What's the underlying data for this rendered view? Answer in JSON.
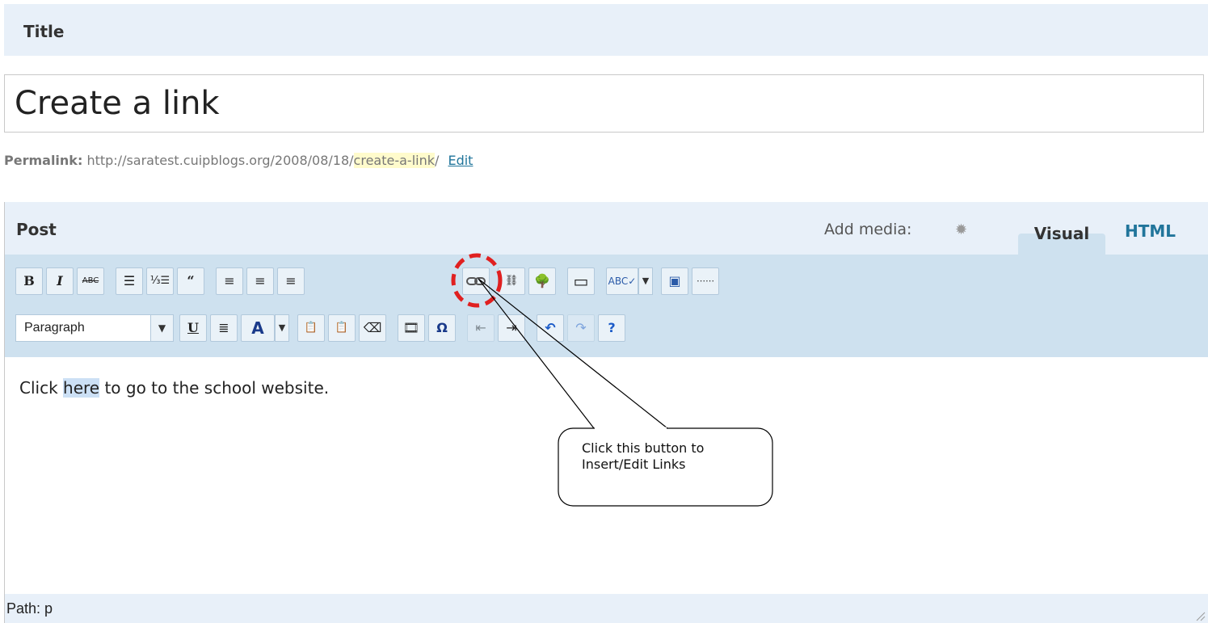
{
  "title_section": {
    "label": "Title",
    "value": "Create a link"
  },
  "permalink": {
    "label": "Permalink:",
    "base": "http://saratest.cuipblogs.org/2008/08/18/",
    "slug": "create-a-link",
    "trail": "/",
    "edit_label": "Edit"
  },
  "editor": {
    "label": "Post",
    "add_media_label": "Add media:",
    "tabs": [
      {
        "label": "Visual"
      },
      {
        "label": "HTML"
      }
    ],
    "format_select": "Paragraph",
    "content": {
      "before": "Click ",
      "highlight": "here",
      "after": " to go to the school website."
    },
    "path": "Path: p"
  },
  "callout": {
    "line1": "Click this button to",
    "line2": "Insert/Edit Links"
  },
  "colors": {
    "header_bg": "#e8f0f9",
    "toolbar_bg": "#cee1ef",
    "link": "#21759b",
    "callout_circle": "#e02020"
  }
}
